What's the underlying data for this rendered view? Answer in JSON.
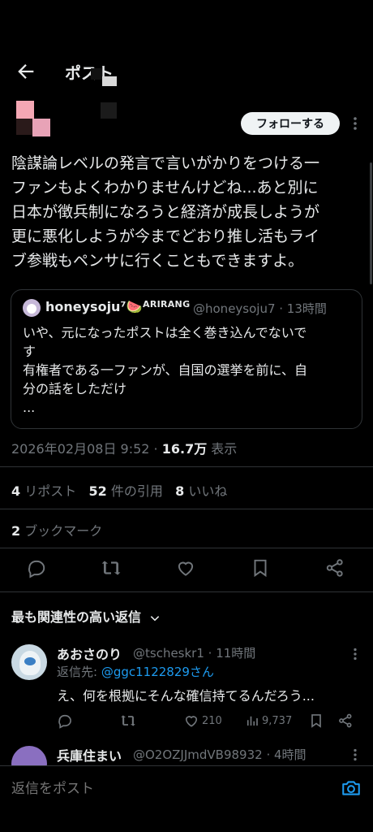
{
  "header": {
    "title": "ポスト"
  },
  "post": {
    "follow_label": "フォローする",
    "lines": [
      "陰謀論レベルの発言で言いがかりをつける一",
      "ファンもよくわかりませんけどね...あと別に",
      "日本が徴兵制になろうと経済が成長しようが",
      "更に悪化しようが今までどおり推し活もライ",
      "ブ参戦もペンサに行くこともできますよ。"
    ],
    "quote": {
      "name": "honeysoju⁷🍉",
      "badge": "ARIRANG",
      "handle": "@honeysoju7 · 13時間",
      "lines": [
        "いや、元になったポストは全く巻き込んでないで",
        "す",
        "有権者である一ファンが、自国の選挙を前に、自",
        "分の話をしただけ",
        "..."
      ]
    },
    "timestamp": "2026年02月08日 9:52 · ",
    "views_count": "16.7万",
    "views_label": " 表示",
    "reposts_count": "4",
    "reposts_label": " リポスト",
    "quotes_count": "52",
    "quotes_label": " 件の引用",
    "likes_count": "8",
    "likes_label": " いいね",
    "bookmarks_count": "2",
    "bookmarks_label": " ブックマーク"
  },
  "replies": {
    "sort_label": "最も関連性の高い返信",
    "items": [
      {
        "name": "あおさのり",
        "handle": "@tscheskr1 · 11時間",
        "reply_to_label": "返信先: ",
        "reply_to_handle": "@ggc1122829さん",
        "text": "え、何を根拠にそんな確信持てるんだろう...",
        "likes": "210",
        "views": "9,737"
      },
      {
        "name": "兵庫住まい",
        "handle": "@O2OZJJmdVB98932 · 4時間"
      }
    ]
  },
  "composer": {
    "placeholder": "返信をポスト"
  },
  "colors": {
    "accent": "#1d9bf0",
    "background": "#000000",
    "text": "#e7e9ea",
    "muted": "#71767b",
    "border": "#2f3336"
  },
  "icons": [
    "back-arrow-icon",
    "more-vertical-icon",
    "reply-icon",
    "repost-icon",
    "like-icon",
    "bookmark-icon",
    "share-icon",
    "chevron-down-icon",
    "views-icon",
    "camera-icon"
  ]
}
